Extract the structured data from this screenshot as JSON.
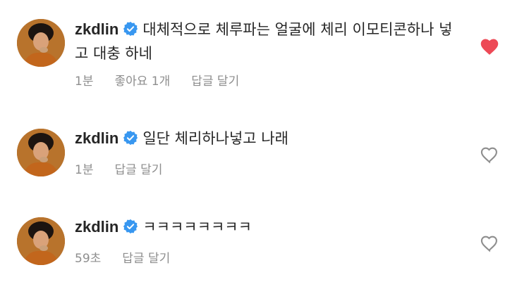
{
  "comments": [
    {
      "username": "zkdlin",
      "text": "대체적으로 체루파는 얼굴에 체리 이모티콘하나 넣고 대충 하네",
      "time": "1분",
      "likes": "좋아요 1개",
      "reply": "답글 달기",
      "liked": true
    },
    {
      "username": "zkdlin",
      "text": "일단 체리하나넣고 나래",
      "time": "1분",
      "likes": "",
      "reply": "답글 달기",
      "liked": false
    },
    {
      "username": "zkdlin",
      "text": "ㅋㅋㅋㅋㅋㅋㅋㅋ",
      "time": "59초",
      "likes": "",
      "reply": "답글 달기",
      "liked": false
    }
  ],
  "colors": {
    "heart_liked": "#ed4956",
    "verified": "#3897f0",
    "meta": "#8e8e8e"
  }
}
